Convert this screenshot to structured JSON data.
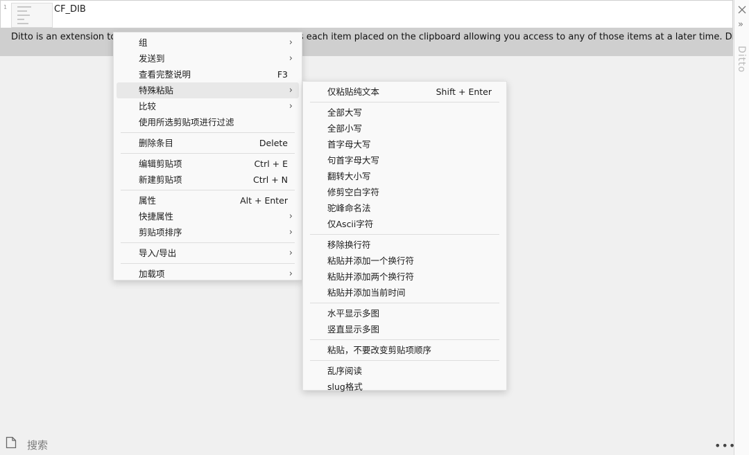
{
  "clip": {
    "row_number": "1",
    "title": "CF_DIB",
    "text": "Ditto is an extension to the standard windows clipboard. It saves each item placed on the clipboard allowing you access to any of those items at a later time. Ditto allows you to save any"
  },
  "side_title": "Ditto",
  "search": {
    "placeholder": "搜索"
  },
  "more_label": "•••",
  "context_menu": {
    "items": [
      {
        "label": "组",
        "shortcut": "",
        "submenu": true
      },
      {
        "label": "发送到",
        "shortcut": "",
        "submenu": true
      },
      {
        "label": "查看完整说明",
        "shortcut": "F3",
        "submenu": false
      },
      {
        "label": "特殊粘贴",
        "shortcut": "",
        "submenu": true
      },
      {
        "label": "比较",
        "shortcut": "",
        "submenu": true
      },
      {
        "label": "使用所选剪贴项进行过滤",
        "shortcut": "",
        "submenu": false
      },
      {
        "label": "删除条目",
        "shortcut": "Delete",
        "submenu": false
      },
      {
        "label": "编辑剪贴项",
        "shortcut": "Ctrl + E",
        "submenu": false
      },
      {
        "label": "新建剪贴项",
        "shortcut": "Ctrl + N",
        "submenu": false
      },
      {
        "label": "属性",
        "shortcut": "Alt + Enter",
        "submenu": false
      },
      {
        "label": "快捷属性",
        "shortcut": "",
        "submenu": true
      },
      {
        "label": "剪贴项排序",
        "shortcut": "",
        "submenu": true
      },
      {
        "label": "导入/导出",
        "shortcut": "",
        "submenu": true
      },
      {
        "label": "加载项",
        "shortcut": "",
        "submenu": true
      }
    ]
  },
  "submenu": {
    "items": [
      {
        "label": "仅粘贴纯文本",
        "shortcut": "Shift + Enter"
      },
      {
        "label": "全部大写",
        "shortcut": ""
      },
      {
        "label": "全部小写",
        "shortcut": ""
      },
      {
        "label": "首字母大写",
        "shortcut": ""
      },
      {
        "label": "句首字母大写",
        "shortcut": ""
      },
      {
        "label": "翻转大小写",
        "shortcut": ""
      },
      {
        "label": "修剪空白字符",
        "shortcut": ""
      },
      {
        "label": "驼峰命名法",
        "shortcut": ""
      },
      {
        "label": "仅Ascii字符",
        "shortcut": ""
      },
      {
        "label": "移除换行符",
        "shortcut": ""
      },
      {
        "label": "粘贴并添加一个换行符",
        "shortcut": ""
      },
      {
        "label": "粘贴并添加两个换行符",
        "shortcut": ""
      },
      {
        "label": "粘贴并添加当前时间",
        "shortcut": ""
      },
      {
        "label": "水平显示多图",
        "shortcut": ""
      },
      {
        "label": "竖直显示多图",
        "shortcut": ""
      },
      {
        "label": "粘贴，不要改变剪贴项顺序",
        "shortcut": ""
      },
      {
        "label": "乱序阅读",
        "shortcut": ""
      },
      {
        "label": "slug格式",
        "shortcut": ""
      }
    ]
  }
}
